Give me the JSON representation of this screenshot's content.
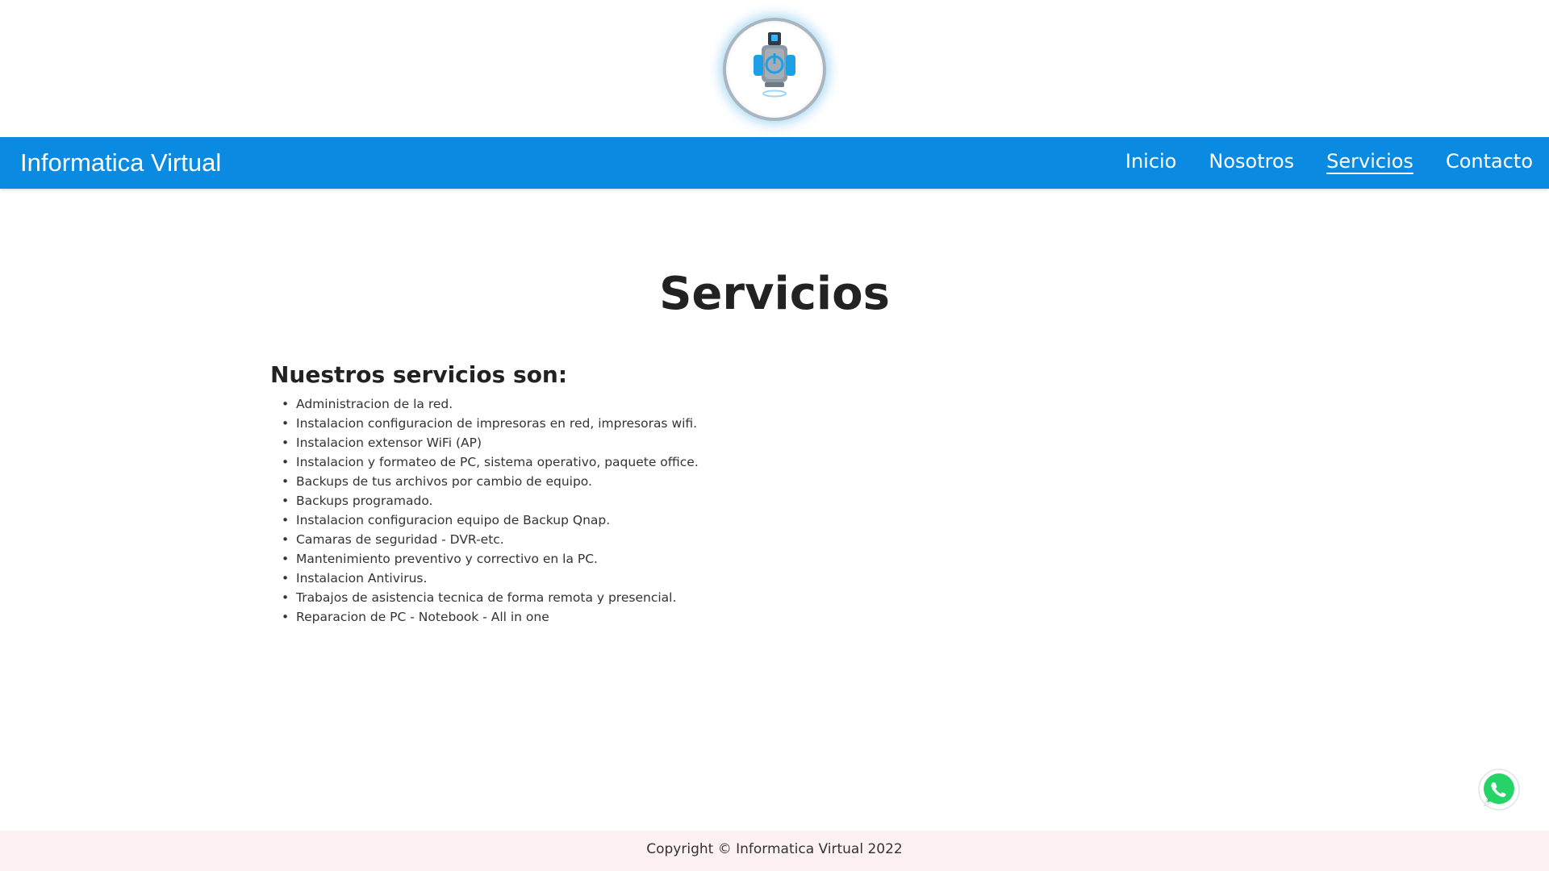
{
  "header": {
    "logo_icon": "power-robot-logo-icon"
  },
  "navbar": {
    "brand": "Informatica Virtual",
    "links": [
      {
        "label": "Inicio",
        "active": false
      },
      {
        "label": "Nosotros",
        "active": false
      },
      {
        "label": "Servicios",
        "active": true
      },
      {
        "label": "Contacto",
        "active": false
      }
    ],
    "background_color": "#0a8ae0"
  },
  "main": {
    "title": "Servicios",
    "section_heading": "Nuestros servicios son:",
    "services": [
      "Administracion de la red.",
      "Instalacion configuracion de impresoras en red, impresoras wifi.",
      "Instalacion extensor WiFi (AP)",
      "Instalacion y formateo de PC, sistema operativo, paquete office.",
      "Backups de tus archivos por cambio de equipo.",
      "Backups programado.",
      "Instalacion configuracion equipo de Backup Qnap.",
      "Camaras de seguridad - DVR-etc.",
      "Mantenimiento preventivo y correctivo en la PC.",
      "Instalacion Antivirus.",
      "Trabajos de asistencia tecnica de forma remota y presencial.",
      "Reparacion de PC - Notebook - All in one"
    ]
  },
  "whatsapp": {
    "icon": "whatsapp-icon",
    "color": "#25d366"
  },
  "footer": {
    "copyright": "Copyright © Informatica Virtual 2022",
    "background_color": "#fdf1f1"
  }
}
